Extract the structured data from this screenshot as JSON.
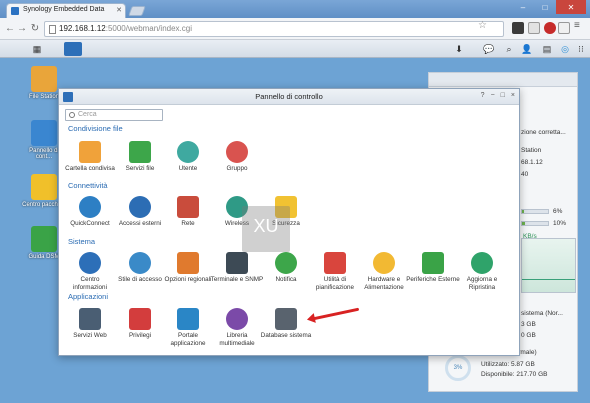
{
  "browser": {
    "tab_title": "Synology Embedded Data",
    "url_host": "192.168.1.12",
    "url_path": ":5000/webman/index.cgi"
  },
  "desktop": {
    "icons": [
      {
        "label": "File Station",
        "color": "#e9a53a"
      },
      {
        "label": "Pannello di cont...",
        "color": "#3a86d0"
      },
      {
        "label": "Centro pacchetti",
        "color": "#f0c02a"
      },
      {
        "label": "Guida DSM",
        "color": "#3aa347"
      }
    ]
  },
  "widget": {
    "line1": "zione corretta...",
    "line2": "Station",
    "line3": "68.1.12",
    "line4": "40",
    "cpu_label": "6%",
    "cpu_value": 0.06,
    "ram_label": "10%",
    "ram_value": 0.1,
    "net_label": "KB/s",
    "volume_title": "sistema (Nor...",
    "v1": "3 GB",
    "v2": "0 GB",
    "volume2_title": "...lume 1 (Normale)",
    "used_label": "Utilizzato: 5.87 GB",
    "free_label": "Disponibile: 217.70 GB",
    "donut": "3%"
  },
  "control_panel": {
    "title": "Pannello di controllo",
    "ctrl_help": "?",
    "ctrl_min": "−",
    "ctrl_max": "□",
    "ctrl_close": "×",
    "search_placeholder": "Cerca",
    "sections": {
      "condivisione": "Condivisione file",
      "connettivita": "Connettività",
      "sistema": "Sistema",
      "applicazioni": "Applicazioni"
    },
    "items": {
      "cartella": "Cartella condivisa",
      "servizi_file": "Servizi file",
      "utente": "Utente",
      "gruppo": "Gruppo",
      "quickconnect": "QuickConnect",
      "accessi": "Accessi esterni",
      "rete": "Rete",
      "wireless": "Wireless",
      "sicurezza": "Sicurezza",
      "centro_info": "Centro informazioni",
      "stile": "Stile di accesso",
      "opzioni": "Opzioni regionali",
      "terminale": "Terminale e SNMP",
      "notifica": "Notifica",
      "utilita": "Utilità di pianificazione",
      "hardware": "Hardware e Alimentazione",
      "periferiche": "Periferiche Esterne",
      "aggiorna": "Aggiorna e Ripristina",
      "servizi_web": "Servizi Web",
      "privilegi": "Privilegi",
      "portale": "Portale applicazione",
      "libreria": "Libreria multimediale",
      "database": "Database sistema"
    }
  }
}
